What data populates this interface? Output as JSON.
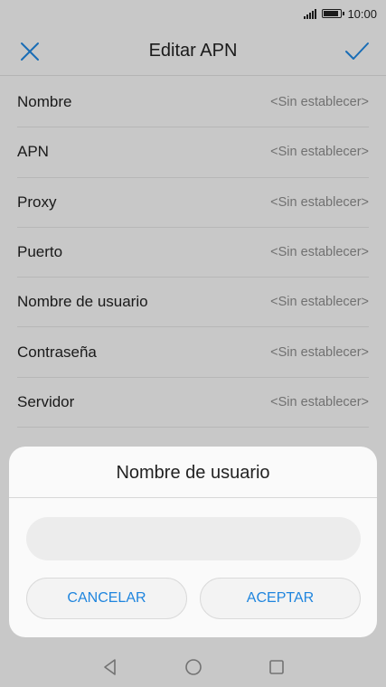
{
  "status": {
    "time": "10:00"
  },
  "app_bar": {
    "title": "Editar APN",
    "close_icon": "close-icon",
    "confirm_icon": "check-icon"
  },
  "settings": [
    {
      "label": "Nombre",
      "value": "<Sin establecer>"
    },
    {
      "label": "APN",
      "value": "<Sin establecer>"
    },
    {
      "label": "Proxy",
      "value": "<Sin establecer>"
    },
    {
      "label": "Puerto",
      "value": "<Sin establecer>"
    },
    {
      "label": "Nombre de usuario",
      "value": "<Sin establecer>"
    },
    {
      "label": "Contraseña",
      "value": "<Sin establecer>"
    },
    {
      "label": "Servidor",
      "value": "<Sin establecer>"
    }
  ],
  "dialog": {
    "title": "Nombre de usuario",
    "input_value": "",
    "cancel_label": "CANCELAR",
    "ok_label": "ACEPTAR"
  },
  "colors": {
    "accent": "#1f85de"
  },
  "nav": [
    "back-icon",
    "home-icon",
    "recents-icon"
  ]
}
